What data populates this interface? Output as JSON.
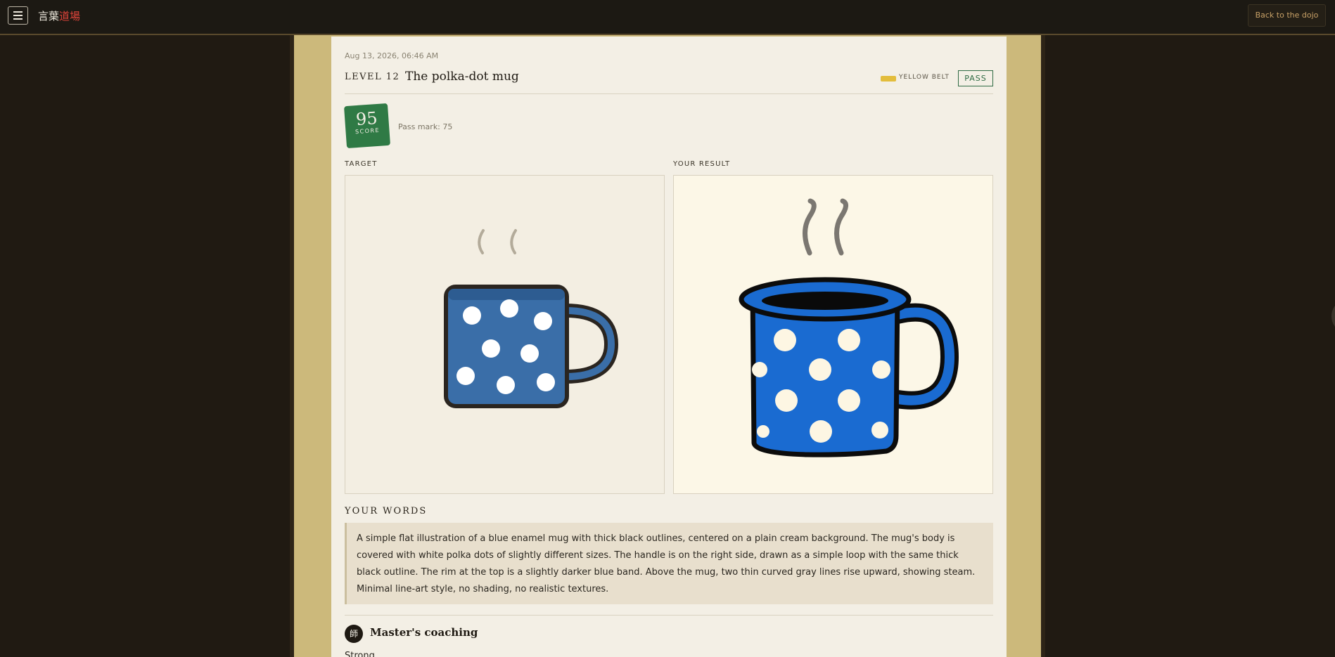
{
  "app": {
    "brand_plain": "言葉",
    "brand_accent": "道場"
  },
  "header": {
    "back_label": "Back to the dojo"
  },
  "attempt": {
    "date": "Aug 13, 2026, 06:46 AM",
    "level_label": "LEVEL 12",
    "title": "The polka-dot mug",
    "belt_label": "YELLOW BELT",
    "belt_color": "#e3bd3c",
    "status": "PASS",
    "score": "95",
    "score_label": "SCORE",
    "pass_mark": "Pass mark: 75"
  },
  "images": {
    "target_label": "TARGET",
    "result_label": "YOUR RESULT"
  },
  "words": {
    "heading": "YOUR WORDS",
    "text": "A simple flat illustration of a blue enamel mug with thick black outlines, centered on a plain cream background. The mug's body is covered with white polka dots of slightly different sizes. The handle is on the right side, drawn as a simple loop with the same thick black outline. The rim at the top is a slightly darker blue band. Above the mug, two thin curved gray lines rise upward, showing steam. Minimal line-art style, no shading, no realistic textures."
  },
  "coaching": {
    "icon": "師",
    "title": "Master's coaching",
    "first_line": "Strong … … … … … … … …"
  },
  "colors": {
    "accent_green": "#2f7a45",
    "brand_red": "#e0443a",
    "mug_blue_target": "#3a6ea8",
    "mug_blue_result": "#1a6bd1"
  }
}
